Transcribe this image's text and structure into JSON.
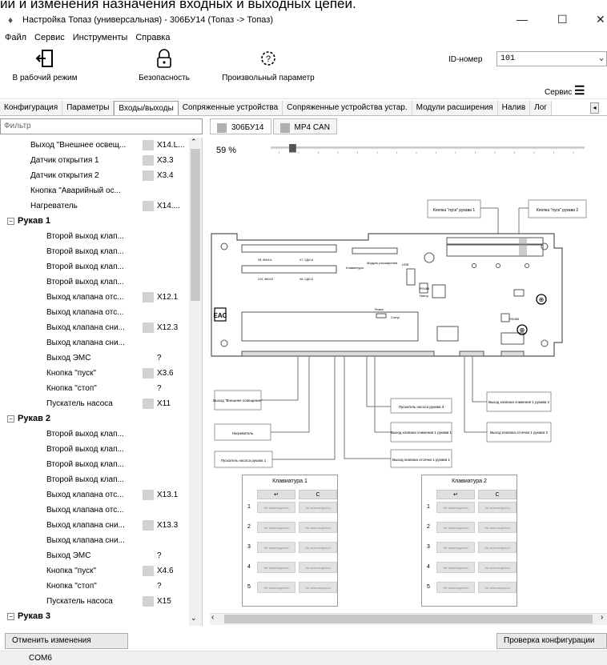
{
  "top_crop_text": "ии и изменения назначения входных и выходных цепей.",
  "window": {
    "title": "Настройка Топаз (универсальная) - 306БУ14 (Топаз -> Топаз)",
    "minimize": "—",
    "maximize": "☐",
    "close": "✕"
  },
  "menu": [
    "Файл",
    "Сервис",
    "Инструменты",
    "Справка"
  ],
  "toolbar": {
    "work_mode": "В рабочий режим",
    "security": "Безопасность",
    "custom_param": "Произвольный параметр",
    "id_label": "ID-номер",
    "id_value": "101",
    "service": "Сервис"
  },
  "tabs": [
    "Конфигурация",
    "Параметры",
    "Входы/выходы",
    "Сопряженные устройства",
    "Сопряженные устройства устар.",
    "Модули расширения",
    "Налив",
    "Лог"
  ],
  "filter_placeholder": "Фильтр",
  "tree": [
    {
      "label": "Выход \"Внешнее освещ...",
      "value": "X14.L...",
      "swatch": true,
      "level": 2
    },
    {
      "label": "Датчик открытия 1",
      "value": "X3.3",
      "swatch": true,
      "level": 2
    },
    {
      "label": "Датчик открытия 2",
      "value": "X3.4",
      "swatch": true,
      "level": 2
    },
    {
      "label": "Кнопка \"Аварийный ос...",
      "value": "",
      "swatch": false,
      "level": 2
    },
    {
      "label": "Нагреватель",
      "value": "X14....",
      "swatch": true,
      "level": 2
    },
    {
      "label": "Рукав 1",
      "value": "",
      "swatch": false,
      "level": 1
    },
    {
      "label": "Второй выход клап...",
      "value": "",
      "swatch": false,
      "level": 3
    },
    {
      "label": "Второй выход клап...",
      "value": "",
      "swatch": false,
      "level": 3
    },
    {
      "label": "Второй выход клап...",
      "value": "",
      "swatch": false,
      "level": 3
    },
    {
      "label": "Второй выход клап...",
      "value": "",
      "swatch": false,
      "level": 3
    },
    {
      "label": "Выход клапана отс...",
      "value": "X12.1",
      "swatch": true,
      "level": 3
    },
    {
      "label": "Выход клапана отс...",
      "value": "",
      "swatch": false,
      "level": 3
    },
    {
      "label": "Выход клапана сни...",
      "value": "X12.3",
      "swatch": true,
      "level": 3
    },
    {
      "label": "Выход клапана сни...",
      "value": "",
      "swatch": false,
      "level": 3
    },
    {
      "label": "Выход ЭМС",
      "value": "?",
      "swatch": false,
      "level": 3
    },
    {
      "label": "Кнопка \"пуск\"",
      "value": "X3.6",
      "swatch": true,
      "level": 3
    },
    {
      "label": "Кнопка \"стоп\"",
      "value": "?",
      "swatch": false,
      "level": 3
    },
    {
      "label": "Пускатель насоса",
      "value": "X11",
      "swatch": true,
      "level": 3
    },
    {
      "label": "Рукав 2",
      "value": "",
      "swatch": false,
      "level": 1
    },
    {
      "label": "Второй выход клап...",
      "value": "",
      "swatch": false,
      "level": 3
    },
    {
      "label": "Второй выход клап...",
      "value": "",
      "swatch": false,
      "level": 3
    },
    {
      "label": "Второй выход клап...",
      "value": "",
      "swatch": false,
      "level": 3
    },
    {
      "label": "Второй выход клап...",
      "value": "",
      "swatch": false,
      "level": 3
    },
    {
      "label": "Выход клапана отс...",
      "value": "X13.1",
      "swatch": true,
      "level": 3
    },
    {
      "label": "Выход клапана отс...",
      "value": "",
      "swatch": false,
      "level": 3
    },
    {
      "label": "Выход клапана сни...",
      "value": "X13.3",
      "swatch": true,
      "level": 3
    },
    {
      "label": "Выход клапана сни...",
      "value": "",
      "swatch": false,
      "level": 3
    },
    {
      "label": "Выход ЭМС",
      "value": "?",
      "swatch": false,
      "level": 3
    },
    {
      "label": "Кнопка \"пуск\"",
      "value": "X4.6",
      "swatch": true,
      "level": 3
    },
    {
      "label": "Кнопка \"стоп\"",
      "value": "?",
      "swatch": false,
      "level": 3
    },
    {
      "label": "Пускатель насоса",
      "value": "X15",
      "swatch": true,
      "level": 3
    },
    {
      "label": "Рукав 3",
      "value": "",
      "swatch": false,
      "level": 1
    },
    {
      "label": "Второй выход клап...",
      "value": "",
      "swatch": false,
      "level": 3
    },
    {
      "label": "Второй выход клап...",
      "value": "",
      "swatch": false,
      "level": 3
    }
  ],
  "subtabs": [
    "306БУ14",
    "MP4 CAN"
  ],
  "zoom": "59 %",
  "zoom_level": 0.07,
  "board": {
    "callouts": [
      "Кнопка \"пуск\" рукава 1",
      "Кнопка \"пуск\" рукава 2",
      "Выход \"Внешнее освещение\"",
      "Нагреватель",
      "Пускатель насоса рукава 1",
      "Пускатель насоса рукава 3",
      "Выход клапана снижения 1 рукава 1",
      "Выход клапана отсечки 1 рукава 1",
      "Выход клапана снижения 1 рукава 2",
      "Выход клапана отсечки 1 рукава 3"
    ],
    "labels": [
      "Модуль расширения",
      "Клавиатура",
      "USB",
      "Режим",
      "Статус",
      "Работа",
      "Настр",
      "RS485"
    ],
    "keyboards": [
      {
        "title": "Клавиатура 1",
        "enter": "↵",
        "clear": "C",
        "rows": [
          "1",
          "2",
          "3",
          "4",
          "5"
        ],
        "cell": "Не используется"
      },
      {
        "title": "Клавиатура 2",
        "enter": "↵",
        "clear": "C",
        "rows": [
          "1",
          "2",
          "3",
          "4",
          "5"
        ],
        "cell": "Не используется"
      }
    ]
  },
  "buttons": {
    "cancel": "Отменить изменения",
    "check": "Проверка конфигурации"
  },
  "status": {
    "port": "COM6"
  }
}
